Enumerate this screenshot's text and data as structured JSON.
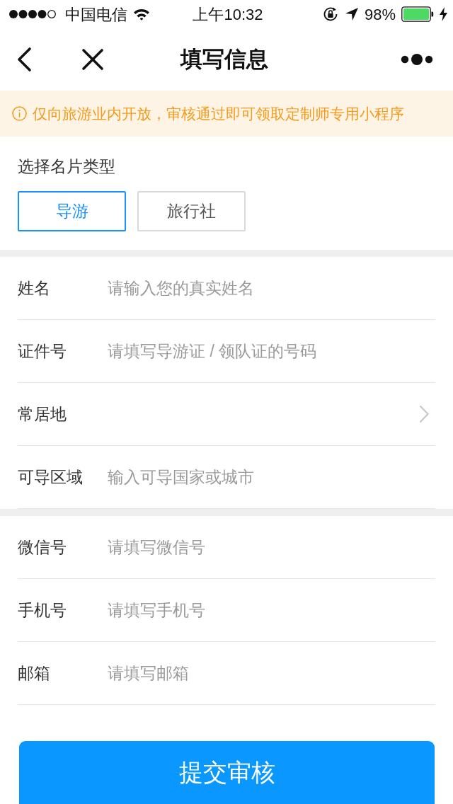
{
  "status_bar": {
    "carrier": "中国电信",
    "time": "上午10:32",
    "battery": "98%"
  },
  "nav": {
    "title": "填写信息"
  },
  "notice": {
    "text": "仅向旅游业内开放，审核通过即可领取定制师专用小程序"
  },
  "card_type": {
    "label": "选择名片类型",
    "options": [
      {
        "label": "导游",
        "selected": true
      },
      {
        "label": "旅行社",
        "selected": false
      }
    ]
  },
  "sections": [
    {
      "fields": [
        {
          "kind": "input",
          "label": "姓名",
          "placeholder": "请输入您的真实姓名"
        },
        {
          "kind": "input",
          "label": "证件号",
          "placeholder": "请填写导游证 / 领队证的号码"
        },
        {
          "kind": "select",
          "label": "常居地"
        },
        {
          "kind": "input",
          "label": "可导区域",
          "placeholder": "输入可导国家或城市"
        }
      ]
    },
    {
      "fields": [
        {
          "kind": "input",
          "label": "微信号",
          "placeholder": "请填写微信号"
        },
        {
          "kind": "input",
          "label": "手机号",
          "placeholder": "请填写手机号"
        },
        {
          "kind": "input",
          "label": "邮箱",
          "placeholder": "请填写邮箱"
        }
      ]
    }
  ],
  "submit_button": "提交审核"
}
